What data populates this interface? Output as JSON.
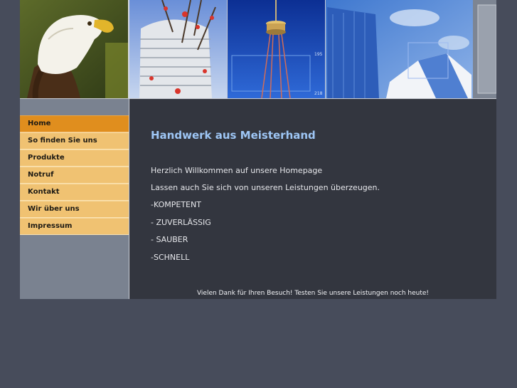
{
  "nav": {
    "items": [
      {
        "label": "Home",
        "active": true
      },
      {
        "label": "So finden Sie uns",
        "active": false
      },
      {
        "label": "Produkte",
        "active": false
      },
      {
        "label": "Notruf",
        "active": false
      },
      {
        "label": "Kontakt",
        "active": false
      },
      {
        "label": "Wir über uns",
        "active": false
      },
      {
        "label": "Impressum",
        "active": false
      }
    ]
  },
  "content": {
    "title": "Handwerk aus Meisterhand",
    "paragraphs": [
      "Herzlich Willkommen auf unsere Homepage",
      "Lassen auch Sie sich von unseren Leistungen überzeugen.",
      "-KOMPETENT",
      "- ZUVERLÄSSIG",
      "- SAUBER",
      "-SCHNELL"
    ],
    "footer": "Vielen Dank für Ihren Besuch! Testen Sie unsere Leistungen noch heute!"
  },
  "banner": {
    "labels": {
      "upper": "195",
      "lower": "218"
    }
  },
  "colors": {
    "page_background": "#474c5b",
    "content_background": "#33363f",
    "sidebar_background": "#7a8290",
    "nav_item": "#f0c272",
    "nav_item_active": "#e08e1e",
    "title": "#9ec6f5"
  }
}
